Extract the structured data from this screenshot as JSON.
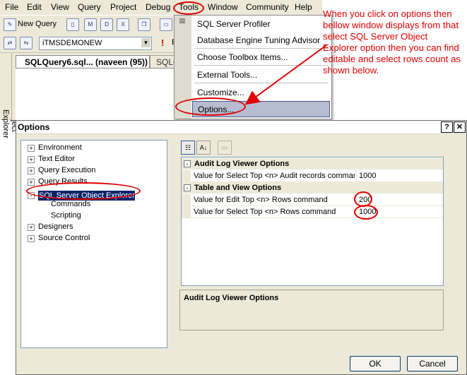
{
  "menubar": {
    "items": [
      {
        "label": "File"
      },
      {
        "label": "Edit"
      },
      {
        "label": "View"
      },
      {
        "label": "Query"
      },
      {
        "label": "Project"
      },
      {
        "label": "Debug"
      },
      {
        "label": "Tools"
      },
      {
        "label": "Window"
      },
      {
        "label": "Community"
      },
      {
        "label": "Help"
      }
    ]
  },
  "toolbar": {
    "new_query_label": "New Query",
    "database_combo_value": "iTMSDEMONEW",
    "execute_label": "E"
  },
  "side_panel_label": "Object Explorer",
  "document_tabs": [
    {
      "label": "SQLQuery6.sql... (naveen (95))"
    },
    {
      "label": "SQLQ"
    }
  ],
  "tools_menu": {
    "items": [
      {
        "label": "SQL Server Profiler"
      },
      {
        "label": "Database Engine Tuning Advisor"
      },
      {
        "label": "Choose Toolbox Items..."
      },
      {
        "label": "External Tools..."
      },
      {
        "label": "Customize..."
      },
      {
        "label": "Options..."
      }
    ]
  },
  "annotation": {
    "text": "When you click on options then bellow window displays from that select SQL Server Object Explorer option then you can find editable and select rows count as shown below."
  },
  "dialog": {
    "title": "Options",
    "help_btn": "?",
    "close_btn": "✕",
    "tree": [
      {
        "label": "Environment",
        "expander": "+"
      },
      {
        "label": "Text Editor",
        "expander": "+"
      },
      {
        "label": "Query Execution",
        "expander": "+"
      },
      {
        "label": "Query Results",
        "expander": "+"
      },
      {
        "label": "SQL Server Object Explorer",
        "expander": "-"
      },
      {
        "label": "Commands",
        "expander": ""
      },
      {
        "label": "Scripting",
        "expander": ""
      },
      {
        "label": "Designers",
        "expander": "+"
      },
      {
        "label": "Source Control",
        "expander": "+"
      }
    ],
    "grid": {
      "categories": [
        {
          "label": "Audit Log Viewer Options",
          "expander": "-",
          "properties": [
            {
              "name": "Value for Select Top <n> Audit records comman",
              "value": "1000"
            }
          ]
        },
        {
          "label": "Table and View Options",
          "expander": "-",
          "properties": [
            {
              "name": "Value for Edit Top <n> Rows command",
              "value": "200"
            },
            {
              "name": "Value for Select Top <n> Rows command",
              "value": "1000"
            }
          ]
        }
      ]
    },
    "description_title": "Audit Log Viewer Options",
    "ok_label": "OK",
    "cancel_label": "Cancel"
  },
  "colors": {
    "annotation_red": "#e00000",
    "selection_navy": "#0a246a",
    "chrome": "#ece9d8"
  }
}
